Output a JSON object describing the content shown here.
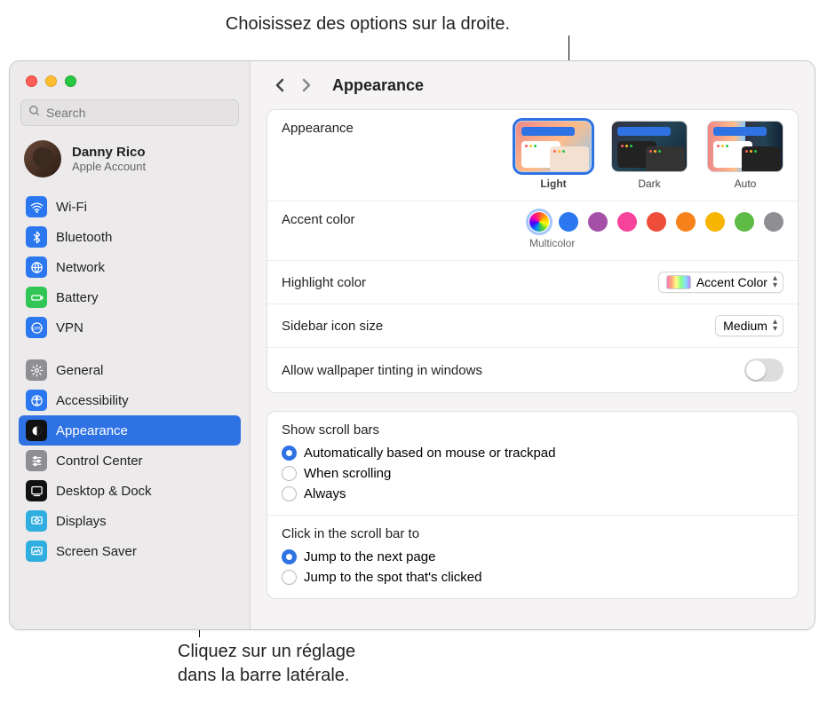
{
  "annotations": {
    "top": "Choisissez des options sur la droite.",
    "bottom_l1": "Cliquez sur un réglage",
    "bottom_l2": "dans la barre latérale."
  },
  "search": {
    "placeholder": "Search"
  },
  "profile": {
    "name": "Danny Rico",
    "sub": "Apple Account"
  },
  "sidebar": {
    "group1": [
      {
        "label": "Wi-Fi",
        "key": "wifi",
        "bg": "#2b77ef",
        "glyph": "wifi"
      },
      {
        "label": "Bluetooth",
        "key": "bluetooth",
        "bg": "#2b77ef",
        "glyph": "bt"
      },
      {
        "label": "Network",
        "key": "network",
        "bg": "#2b77ef",
        "glyph": "globe"
      },
      {
        "label": "Battery",
        "key": "battery",
        "bg": "#30c554",
        "glyph": "battery"
      },
      {
        "label": "VPN",
        "key": "vpn",
        "bg": "#2b77ef",
        "glyph": "vpn"
      }
    ],
    "group2": [
      {
        "label": "General",
        "key": "general",
        "bg": "#8e8e93",
        "glyph": "gear"
      },
      {
        "label": "Accessibility",
        "key": "accessibility",
        "bg": "#2b77ef",
        "glyph": "access"
      },
      {
        "label": "Appearance",
        "key": "appearance",
        "bg": "#111",
        "glyph": "appear",
        "selected": true
      },
      {
        "label": "Control Center",
        "key": "controlcenter",
        "bg": "#8e8e93",
        "glyph": "sliders"
      },
      {
        "label": "Desktop & Dock",
        "key": "desktop",
        "bg": "#111",
        "glyph": "dock"
      },
      {
        "label": "Displays",
        "key": "displays",
        "bg": "#30aee0",
        "glyph": "display"
      },
      {
        "label": "Screen Saver",
        "key": "screensaver",
        "bg": "#30aee0",
        "glyph": "ssaver"
      }
    ]
  },
  "page": {
    "title": "Appearance",
    "appearance_label": "Appearance",
    "themes": [
      {
        "label": "Light",
        "selected": true
      },
      {
        "label": "Dark",
        "selected": false
      },
      {
        "label": "Auto",
        "selected": false
      }
    ],
    "accent_label": "Accent color",
    "accent_selected_name": "Multicolor",
    "accent_colors": [
      "multicolor",
      "#2b77ef",
      "#a550a7",
      "#f7439b",
      "#ee4d3a",
      "#f7821b",
      "#f7b500",
      "#5dbb46",
      "#8e8e93"
    ],
    "highlight_label": "Highlight color",
    "highlight_value": "Accent Color",
    "sidebar_size_label": "Sidebar icon size",
    "sidebar_size_value": "Medium",
    "wallpaper_tint_label": "Allow wallpaper tinting in windows",
    "scroll": {
      "header": "Show scroll bars",
      "options": [
        "Automatically based on mouse or trackpad",
        "When scrolling",
        "Always"
      ],
      "selected": 0
    },
    "click": {
      "header": "Click in the scroll bar to",
      "options": [
        "Jump to the next page",
        "Jump to the spot that's clicked"
      ],
      "selected": 0
    }
  }
}
